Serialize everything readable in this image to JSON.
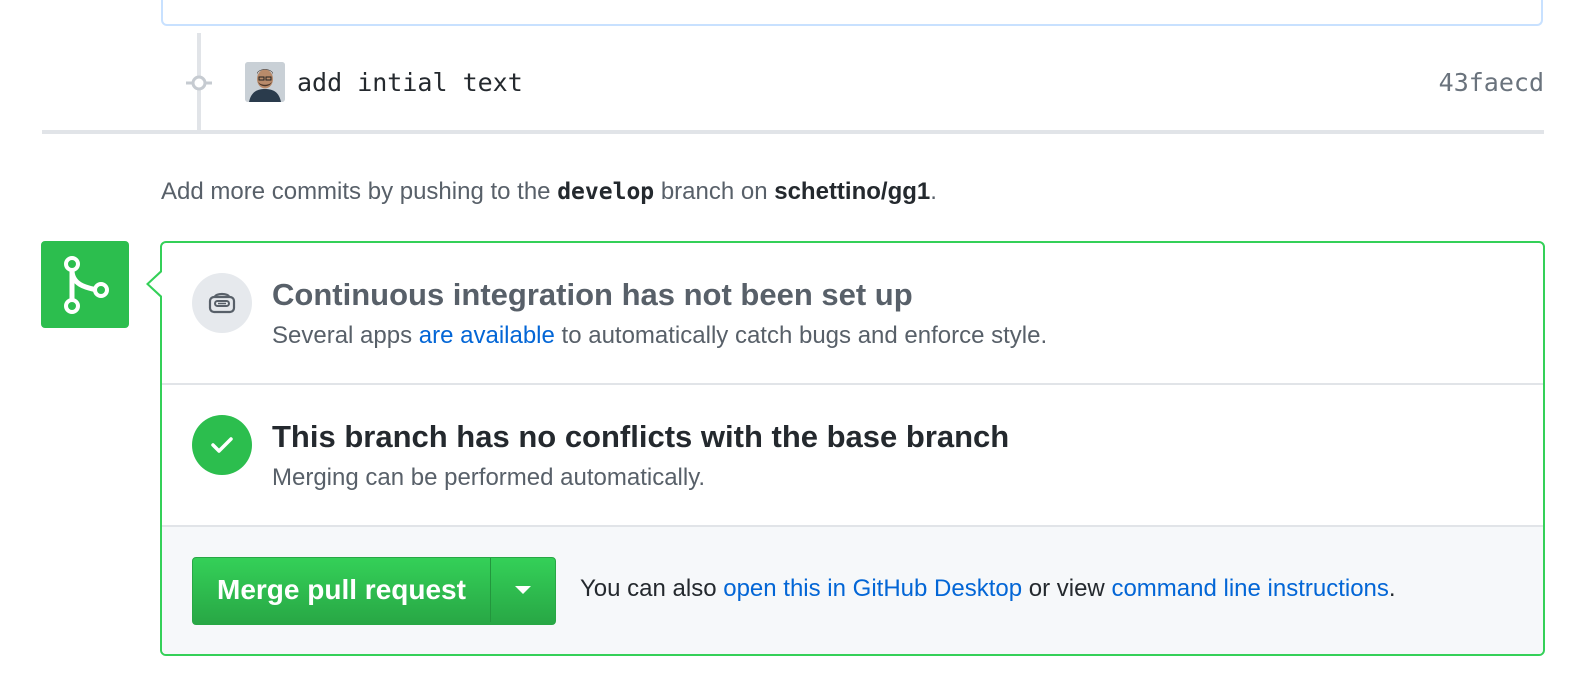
{
  "commit": {
    "message": "add intial text",
    "sha": "43faecd",
    "avatar_icon": "user-avatar"
  },
  "push_hint": {
    "prefix": "Add more commits by pushing to the",
    "branch": "develop",
    "middle": "branch on",
    "repo": "schettino/gg1",
    "suffix": "."
  },
  "merge_badge_icon": "git-merge-icon",
  "ci": {
    "icon": "robot-icon",
    "title": "Continuous integration has not been set up",
    "desc_prefix": "Several apps",
    "desc_link": "are available",
    "desc_suffix": "to automatically catch bugs and enforce style."
  },
  "conflicts": {
    "icon": "check-icon",
    "title": "This branch has no conflicts with the base branch",
    "desc": "Merging can be performed automatically."
  },
  "merge": {
    "button_label": "Merge pull request",
    "dropdown_icon": "caret-down-icon",
    "hint_prefix": "You can also",
    "hint_link_desktop": "open this in GitHub Desktop",
    "hint_middle": "or view",
    "hint_link_cli": "command line instructions",
    "hint_suffix": "."
  },
  "colors": {
    "green": "#2cbe4e",
    "green_border": "#34d058",
    "link": "#0366d6",
    "muted": "#586069"
  }
}
